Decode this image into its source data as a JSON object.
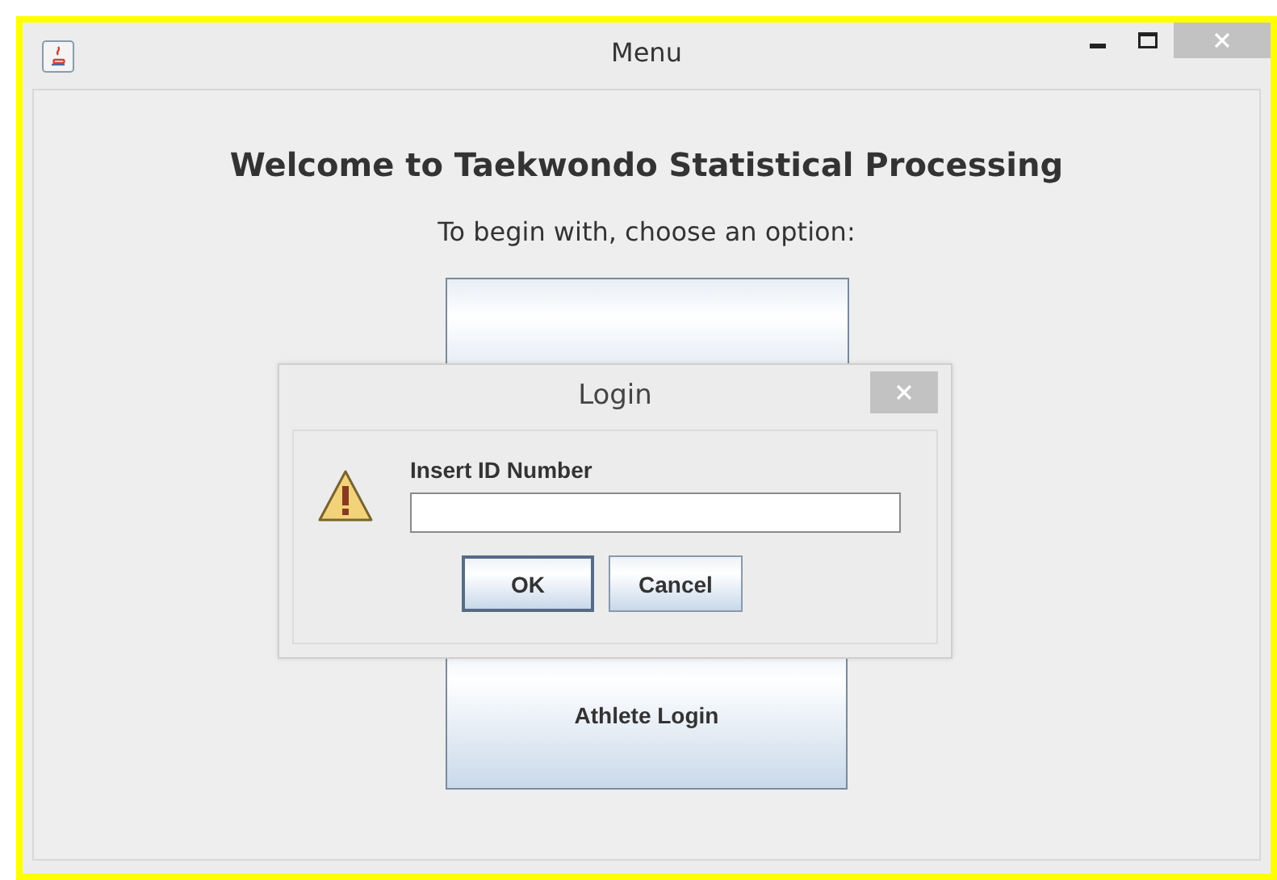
{
  "window": {
    "title": "Menu"
  },
  "heading": "Welcome to Taekwondo Statistical Processing",
  "prompt": "To begin with, choose an option:",
  "options": [
    {
      "kind": "covered"
    },
    {
      "kind": "button",
      "label": "Athlete Login"
    }
  ],
  "dialog": {
    "title": "Login",
    "message": "Insert ID Number",
    "buttons": [
      {
        "label": "OK",
        "default": true
      },
      {
        "label": "Cancel",
        "default": false
      }
    ]
  }
}
